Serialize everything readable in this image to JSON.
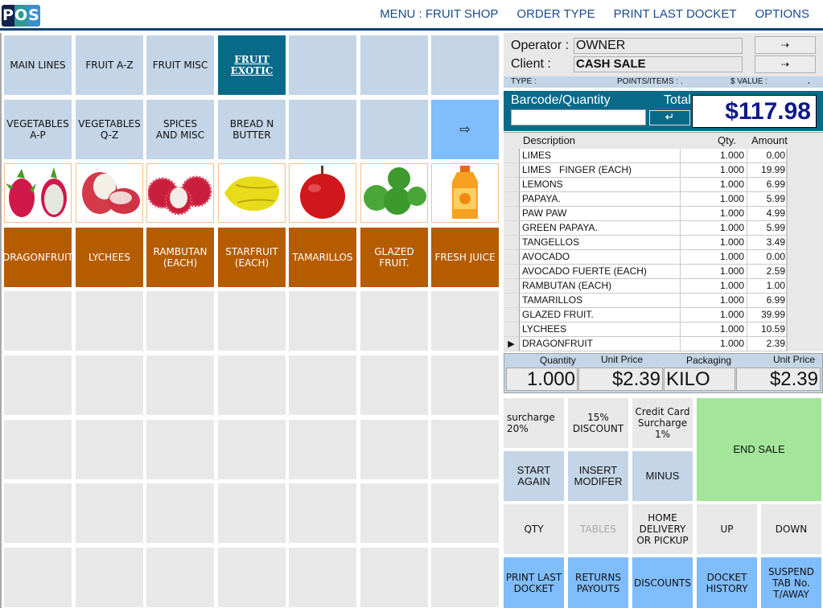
{
  "app": {
    "logo_letters": [
      "P",
      "O",
      "S"
    ]
  },
  "nav": {
    "items": [
      "MENU : FRUIT SHOP",
      "ORDER TYPE",
      "PRINT LAST DOCKET",
      "OPTIONS"
    ]
  },
  "categories": {
    "row1": [
      "MAIN LINES",
      "FRUIT A-Z",
      "FRUIT MISC",
      "FRUIT EXOTIC",
      "",
      "",
      ""
    ],
    "row2": [
      "VEGETABLES A-P",
      "VEGETABLES Q-Z",
      "SPICES AND MISC",
      "BREAD N BUTTER",
      "",
      ""
    ],
    "active": "FRUIT EXOTIC",
    "next_icon": "right-arrow-icon",
    "next_glyph": "⇨"
  },
  "products": [
    {
      "label": "DRAGONFRUIT",
      "image": "dragonfruit-image"
    },
    {
      "label": "LYCHEES",
      "image": "lychees-image"
    },
    {
      "label": "RAMBUTAN (EACH)",
      "image": "rambutan-image"
    },
    {
      "label": "STARFRUIT (EACH)",
      "image": "starfruit-image"
    },
    {
      "label": "TAMARILLOS",
      "image": "tamarillo-image"
    },
    {
      "label": "GLAZED FRUIT.",
      "image": "glazed-fruit-image"
    },
    {
      "label": "FRESH JUICE",
      "image": "fresh-juice-image"
    }
  ],
  "operator": {
    "operator_label": "Operator :",
    "operator_value": "OWNER",
    "client_label": "Client :",
    "client_value": "CASH SALE",
    "arrow_glyph": "⇢"
  },
  "status": {
    "type_label": "TYPE :",
    "points_label": "POINTS/ITEMS : .",
    "value_label": "$ VALUE :",
    "value": "."
  },
  "barcode": {
    "label": "Barcode/Quantity",
    "value": "",
    "enter_glyph": "↵",
    "total_label": "Total",
    "total_value": "$117.98"
  },
  "receipt": {
    "headers": {
      "description": "Description",
      "qty": "Qty.",
      "amount": "Amount"
    },
    "rows": [
      {
        "description": "LIMES",
        "qty": "1.000",
        "amount": "0.00"
      },
      {
        "description": "LIMES   FINGER (EACH)",
        "qty": "1.000",
        "amount": "19.99"
      },
      {
        "description": "LEMONS",
        "qty": "1.000",
        "amount": "6.99"
      },
      {
        "description": "PAPAYA.",
        "qty": "1.000",
        "amount": "5.99"
      },
      {
        "description": "PAW PAW",
        "qty": "1.000",
        "amount": "4.99"
      },
      {
        "description": "GREEN PAPAYA.",
        "qty": "1.000",
        "amount": "5.99"
      },
      {
        "description": "TANGELLOS",
        "qty": "1.000",
        "amount": "3.49"
      },
      {
        "description": "AVOCADO",
        "qty": "1.000",
        "amount": "0.00"
      },
      {
        "description": "AVOCADO FUERTE (EACH)",
        "qty": "1.000",
        "amount": "2.59"
      },
      {
        "description": "RAMBUTAN (EACH)",
        "qty": "1.000",
        "amount": "1.00"
      },
      {
        "description": "TAMARILLOS",
        "qty": "1.000",
        "amount": "6.99"
      },
      {
        "description": "GLAZED FRUIT.",
        "qty": "1.000",
        "amount": "39.99"
      },
      {
        "description": "LYCHEES",
        "qty": "1.000",
        "amount": "10.59"
      },
      {
        "description": "DRAGONFRUIT",
        "qty": "1.000",
        "amount": "2.39",
        "selected": true
      }
    ],
    "selected_glyph": "▶"
  },
  "detail": {
    "quantity_label": "Quantity",
    "quantity_value": "1.000",
    "unit_price_label": "Unit Price",
    "unit_price_value": "$2.39",
    "packaging_label": "Packaging",
    "packaging_value": "KILO",
    "unit_price2_label": "Unit Price",
    "unit_price2_value": "$2.39"
  },
  "functions": {
    "surcharge": "surcharge\n20%",
    "discount15": "15%\nDISCOUNT",
    "cc_surcharge": "Credit Card\nSurcharge\n1%",
    "end_sale": "END SALE",
    "start_again": "START\nAGAIN",
    "insert_modifier": "INSERT\nMODIFER",
    "minus": "MINUS",
    "qty": "QTY",
    "tables": "TABLES",
    "home_delivery": "HOME\nDELIVERY\nOR PICKUP",
    "up": "UP",
    "down": "DOWN",
    "print_last_docket": "PRINT LAST\nDOCKET",
    "returns_payouts": "RETURNS\nPAYOUTS",
    "discounts": "DISCOUNTS",
    "docket_history": "DOCKET\nHISTORY",
    "suspend": "SUSPEND\nTAB No.\nT/AWAY"
  },
  "colors": {
    "header_rule": "#0b3f74",
    "category_tile": "#c3d5e6",
    "category_active": "#086a89",
    "product_tile": "#b65c00",
    "empty_tile": "#e8e8e8",
    "total_text": "#101a8a",
    "end_sale": "#a3e69a",
    "bright_blue": "#80bdfc"
  }
}
